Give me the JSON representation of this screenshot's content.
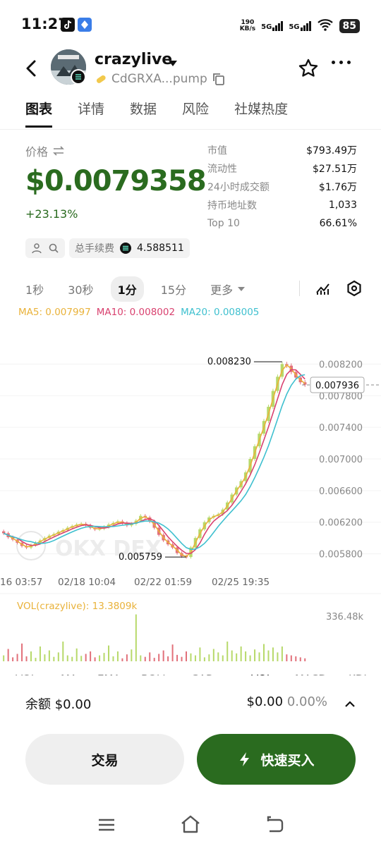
{
  "status_bar": {
    "time": "11:27",
    "net_speed_value": "190",
    "net_speed_unit": "KB/s",
    "signal_1": "5G",
    "signal_2": "5G",
    "battery": "85"
  },
  "header": {
    "token_name": "crazylive",
    "address": "CdGRXA...pump"
  },
  "tabs": [
    "图表",
    "详情",
    "数据",
    "风险",
    "社媒热度"
  ],
  "price_section": {
    "label": "价格",
    "price": "$0.0079358",
    "change": "+23.13%",
    "fee_label": "总手续费",
    "fee_value": "4.588511"
  },
  "stats": [
    {
      "label": "市值",
      "value": "$793.49万"
    },
    {
      "label": "流动性",
      "value": "$27.51万"
    },
    {
      "label": "24小时成交额",
      "value": "$1.76万"
    },
    {
      "label": "持币地址数",
      "value": "1,033"
    },
    {
      "label": "Top 10",
      "value": "66.61%"
    }
  ],
  "intervals": {
    "items": [
      "1秒",
      "30秒",
      "1分",
      "15分"
    ],
    "active": "1分",
    "more": "更多"
  },
  "ma_legend": {
    "ma5": "MA5: 0.007997",
    "ma10": "MA10: 0.008002",
    "ma20": "MA20: 0.008005"
  },
  "chart_data": {
    "type": "candlestick",
    "y_ticks": [
      "0.008200",
      "0.007800",
      "0.007400",
      "0.007000",
      "0.006600",
      "0.006200",
      "0.005800"
    ],
    "ylim": [
      0.0056,
      0.0084
    ],
    "x_ticks": [
      "16 03:57",
      "02/18 10:04",
      "02/22 01:59",
      "02/25 19:35"
    ],
    "current_price": "0.007936",
    "high_label": "0.008230",
    "low_label": "0.005759",
    "close_path": [
      0.00606,
      0.00601,
      0.00598,
      0.00594,
      0.0059,
      0.00588,
      0.00591,
      0.00594,
      0.00597,
      0.006,
      0.00603,
      0.00605,
      0.00608,
      0.0061,
      0.00613,
      0.00615,
      0.00617,
      0.00618,
      0.00616,
      0.00613,
      0.00611,
      0.00612,
      0.00614,
      0.00617,
      0.00619,
      0.00621,
      0.00619,
      0.00616,
      0.00618,
      0.00622,
      0.00628,
      0.00626,
      0.00621,
      0.00613,
      0.00604,
      0.00597,
      0.00592,
      0.00588,
      0.00581,
      0.00577,
      0.00576,
      0.00588,
      0.006,
      0.00611,
      0.0062,
      0.00626,
      0.00628,
      0.0063,
      0.00636,
      0.00645,
      0.00655,
      0.00664,
      0.00672,
      0.00683,
      0.007,
      0.00716,
      0.00732,
      0.00748,
      0.00766,
      0.00786,
      0.00804,
      0.0082,
      0.00818,
      0.0081,
      0.00803,
      0.00797,
      0.00794
    ],
    "volume_label": "VOL(crazylive): 13.3809k",
    "volume_max_label": "336.48k",
    "volumes": [
      0.12,
      0.25,
      0.08,
      0.15,
      0.36,
      0.1,
      0.2,
      0.07,
      0.3,
      0.14,
      0.22,
      0.09,
      0.18,
      0.4,
      0.12,
      0.09,
      0.26,
      0.11,
      0.15,
      0.2,
      0.08,
      0.12,
      0.17,
      0.32,
      0.1,
      0.2,
      0.06,
      0.14,
      0.24,
      0.95,
      0.12,
      0.09,
      0.18,
      0.07,
      0.15,
      0.22,
      0.1,
      0.34,
      0.13,
      0.09,
      0.2,
      0.16,
      0.12,
      0.28,
      0.08,
      0.14,
      0.25,
      0.18,
      0.12,
      0.4,
      0.22,
      0.16,
      0.3,
      0.2,
      0.12,
      0.24,
      0.18,
      0.35,
      0.22,
      0.28,
      0.18,
      0.3,
      0.14,
      0.12,
      0.1,
      0.08,
      0.06
    ],
    "indicator_tabs": [
      "VOL",
      "MA",
      "EMA",
      "BOLL",
      "SAR",
      "VOL",
      "MACD",
      "KDJ"
    ],
    "watermark": "OKX DEX"
  },
  "balance": {
    "label": "余额",
    "amount": "$0.00",
    "value": "$0.00",
    "pct": "0.00%"
  },
  "buttons": {
    "trade": "交易",
    "quick_buy": "快速买入"
  },
  "colors": {
    "accent": "#2a6b1f",
    "up": "#b7d96a",
    "down": "#e2707a",
    "ma5": "#e9b23a",
    "ma10": "#d9416f",
    "ma20": "#3fc0cf"
  }
}
